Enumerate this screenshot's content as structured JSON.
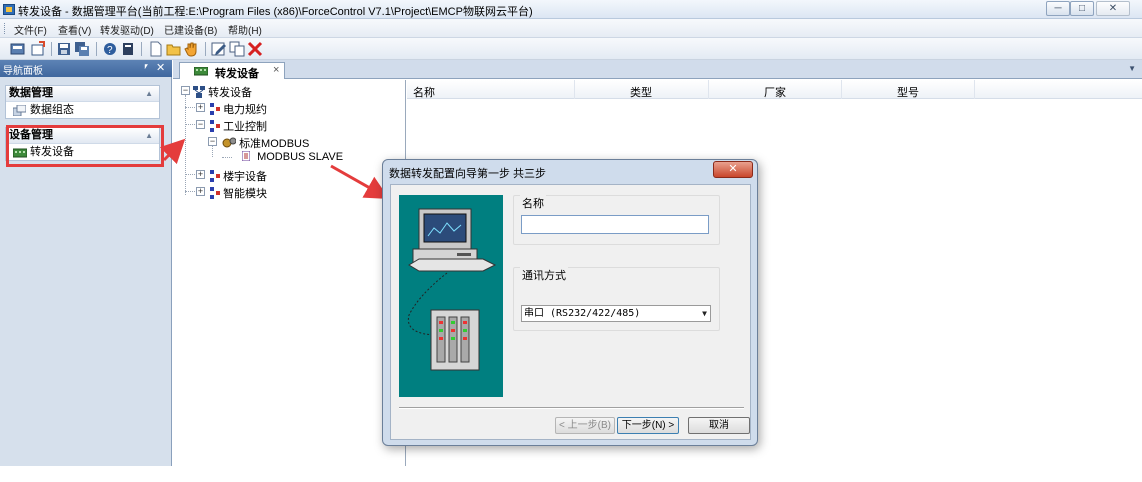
{
  "window": {
    "title": "转发设备 - 数据管理平台(当前工程:E:\\Program Files (x86)\\ForceControl V7.1\\Project\\EMCP物联网云平台)",
    "buttons": [
      "minimize",
      "maximize",
      "close"
    ]
  },
  "menu": [
    "文件(F)",
    "查看(V)",
    "转发驱动(D)",
    "已建设备(B)",
    "帮助(H)"
  ],
  "toolbar": {
    "icons": [
      "config-icon",
      "new-window-icon",
      "save-icon",
      "save-all-icon",
      "help-icon",
      "book-icon",
      "new-file-icon",
      "open-folder-icon",
      "hand-icon",
      "edit-icon",
      "copy-icon",
      "delete-icon"
    ],
    "colors": {
      "delete": "#d62020"
    }
  },
  "nav": {
    "title": "导航面板",
    "pin": "⌂",
    "close": "✕",
    "groups": [
      {
        "title": "数据管理",
        "items": [
          "数据组态"
        ]
      },
      {
        "title": "设备管理",
        "items": [
          "转发设备"
        ]
      }
    ]
  },
  "tab": {
    "label": "转发设备",
    "close": "×"
  },
  "tree": {
    "root": "转发设备",
    "nodes": [
      "电力规约",
      "工业控制",
      "标准MODBUS",
      "MODBUS SLAVE",
      "楼宇设备",
      "智能模块"
    ]
  },
  "list": {
    "columns": [
      "名称",
      "类型",
      "厂家",
      "型号"
    ]
  },
  "dialog": {
    "title": "数据转发配置向导第一步 共三步",
    "name_label": "名称",
    "name_value": "",
    "comm_label": "通讯方式",
    "comm_value": "串口 (RS232/422/485)",
    "buttons": {
      "back": "< 上一步(B)",
      "next": "下一步(N) >",
      "cancel": "取消"
    },
    "colors": {
      "illustration_bg": "#007f80"
    }
  },
  "annotation_color": "#e43c3c"
}
